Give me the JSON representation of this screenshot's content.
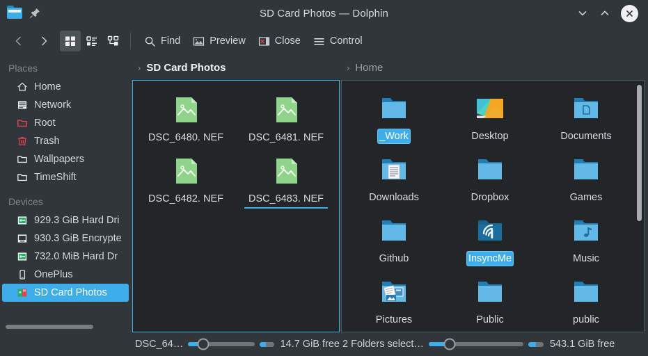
{
  "window": {
    "title": "SD Card Photos — Dolphin",
    "app_icon": "folder-icon",
    "pin_icon": "pin-icon",
    "minimize_label": "v",
    "maximize_label": "^",
    "close_label": "×",
    "accent_color": "#3daee9",
    "background_color": "#31363b",
    "view_background_color": "#232629"
  },
  "toolbar": {
    "back_label": "‹",
    "forward_label": "›",
    "view_modes": [
      {
        "name": "icons-view",
        "label": "Icons",
        "active": true
      },
      {
        "name": "compact-view",
        "label": "Compact",
        "active": false
      },
      {
        "name": "details-view",
        "label": "Details",
        "active": false
      }
    ],
    "actions": [
      {
        "name": "find",
        "label": "Find",
        "icon": "search-icon"
      },
      {
        "name": "preview",
        "label": "Preview",
        "icon": "image-preview-icon"
      },
      {
        "name": "close",
        "label": "Close",
        "icon": "close-panel-icon"
      },
      {
        "name": "control",
        "label": "Control",
        "icon": "hamburger-menu-icon"
      }
    ]
  },
  "sidebar": {
    "sections": [
      {
        "title": "Places",
        "items": [
          {
            "label": "Home",
            "icon": "home-icon",
            "selected": false
          },
          {
            "label": "Network",
            "icon": "network-icon",
            "selected": false
          },
          {
            "label": "Root",
            "icon": "root-folder-icon",
            "selected": false
          },
          {
            "label": "Trash",
            "icon": "trash-icon",
            "selected": false
          },
          {
            "label": "Wallpapers",
            "icon": "folder-icon",
            "selected": false
          },
          {
            "label": "TimeShift",
            "icon": "folder-icon",
            "selected": false
          }
        ]
      },
      {
        "title": "Devices",
        "items": [
          {
            "label": "929.3 GiB Hard Dri",
            "icon": "hard-drive-icon",
            "selected": false
          },
          {
            "label": "930.3 GiB Encrypte",
            "icon": "encrypted-drive-icon",
            "selected": false
          },
          {
            "label": "732.0 MiB Hard Dr",
            "icon": "hard-drive-icon",
            "selected": false
          },
          {
            "label": "OnePlus",
            "icon": "phone-icon",
            "selected": false
          },
          {
            "label": "SD Card Photos",
            "icon": "sd-card-icon",
            "selected": true
          }
        ]
      }
    ]
  },
  "left_pane": {
    "breadcrumb": "SD Card Photos",
    "active": true,
    "items": [
      {
        "label": "DSC_6480.\nNEF",
        "icon": "image-file-icon",
        "selected": false,
        "hovered": false
      },
      {
        "label": "DSC_6481.\nNEF",
        "icon": "image-file-icon",
        "selected": false,
        "hovered": false
      },
      {
        "label": "DSC_6482.\nNEF",
        "icon": "image-file-icon",
        "selected": false,
        "hovered": false
      },
      {
        "label": "DSC_6483.\nNEF",
        "icon": "image-file-icon",
        "selected": false,
        "hovered": true
      }
    ]
  },
  "right_pane": {
    "breadcrumb": "Home",
    "active": false,
    "items": [
      {
        "label": "_Work",
        "icon": "folder-icon",
        "selected": true
      },
      {
        "label": "Desktop",
        "icon": "desktop-wallpaper-icon",
        "selected": false
      },
      {
        "label": "Documents",
        "icon": "documents-folder-icon",
        "selected": false
      },
      {
        "label": "Downloads",
        "icon": "downloads-folder-icon",
        "selected": false
      },
      {
        "label": "Dropbox",
        "icon": "folder-icon",
        "selected": false
      },
      {
        "label": "Games",
        "icon": "folder-icon",
        "selected": false
      },
      {
        "label": "Github",
        "icon": "folder-icon",
        "selected": false
      },
      {
        "label": "InsyncMe",
        "icon": "insync-folder-icon",
        "selected": true
      },
      {
        "label": "Music",
        "icon": "music-folder-icon",
        "selected": false
      },
      {
        "label": "Pictures",
        "icon": "pictures-folder-icon",
        "selected": false
      },
      {
        "label": "Public",
        "icon": "folder-icon",
        "selected": false
      },
      {
        "label": "public",
        "icon": "folder-icon",
        "selected": false
      }
    ]
  },
  "statusbar": {
    "left": {
      "text": "DSC_64…",
      "zoom_percent": 18,
      "free_space": "14.7 GiB free",
      "space_used_percent": 42
    },
    "right": {
      "text": "2 Folders select…",
      "zoom_percent": 18,
      "free_space": "543.1 GiB free",
      "space_used_percent": 52
    }
  }
}
